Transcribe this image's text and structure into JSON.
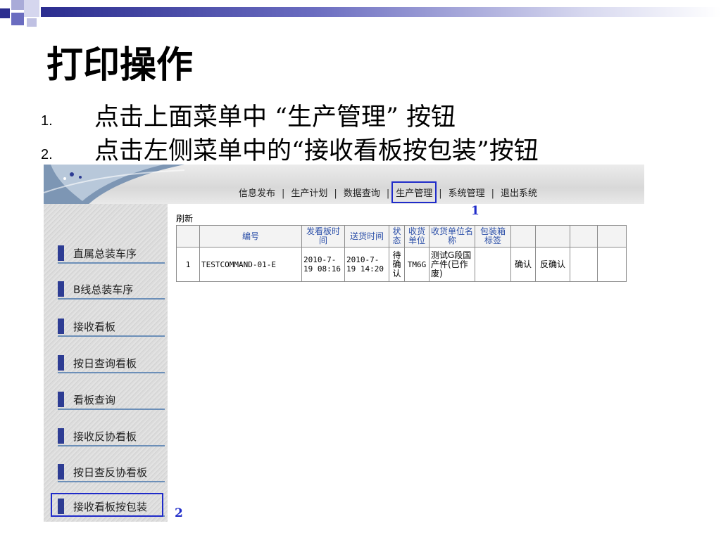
{
  "slide": {
    "title": "打印操作",
    "steps": [
      {
        "num": "1.",
        "text": "点击上面菜单中 “生产管理” 按钮"
      },
      {
        "num": "2.",
        "text": "点击左侧菜单中的“接收看板按包装”按钮"
      }
    ]
  },
  "app": {
    "menu": [
      "信息发布",
      "生产计划",
      "数据查询",
      "生产管理",
      "系统管理",
      "退出系统"
    ],
    "menu_separator": "|",
    "highlighted_menu": "生产管理",
    "sidebar": [
      "直属总装车序",
      "B线总装车序",
      "接收看板",
      "按日查询看板",
      "看板查询",
      "接收反协看板",
      "按日查反协看板",
      "接收看板按包装"
    ],
    "refresh_label": "刷新",
    "table": {
      "headers": [
        "",
        "编号",
        "发看板时间",
        "送货时间",
        "状态",
        "收货单位",
        "收货单位名称",
        "包装箱标签",
        "",
        "",
        "",
        ""
      ],
      "rows": [
        [
          "1",
          "TESTCOMMAND-01-E",
          "2010-7-19 08:16",
          "2010-7-19 14:20",
          "待确认",
          "TM6G",
          "测试G段国产件(已作废)",
          "",
          "确认",
          "反确认",
          "",
          ""
        ]
      ]
    },
    "annotations": {
      "menu_marker": "1",
      "sidebar_marker": "2"
    },
    "colors": {
      "highlight": "#1f2bc9",
      "sidebar_bar": "#2d3c93",
      "link": "#1a3ea3"
    }
  }
}
